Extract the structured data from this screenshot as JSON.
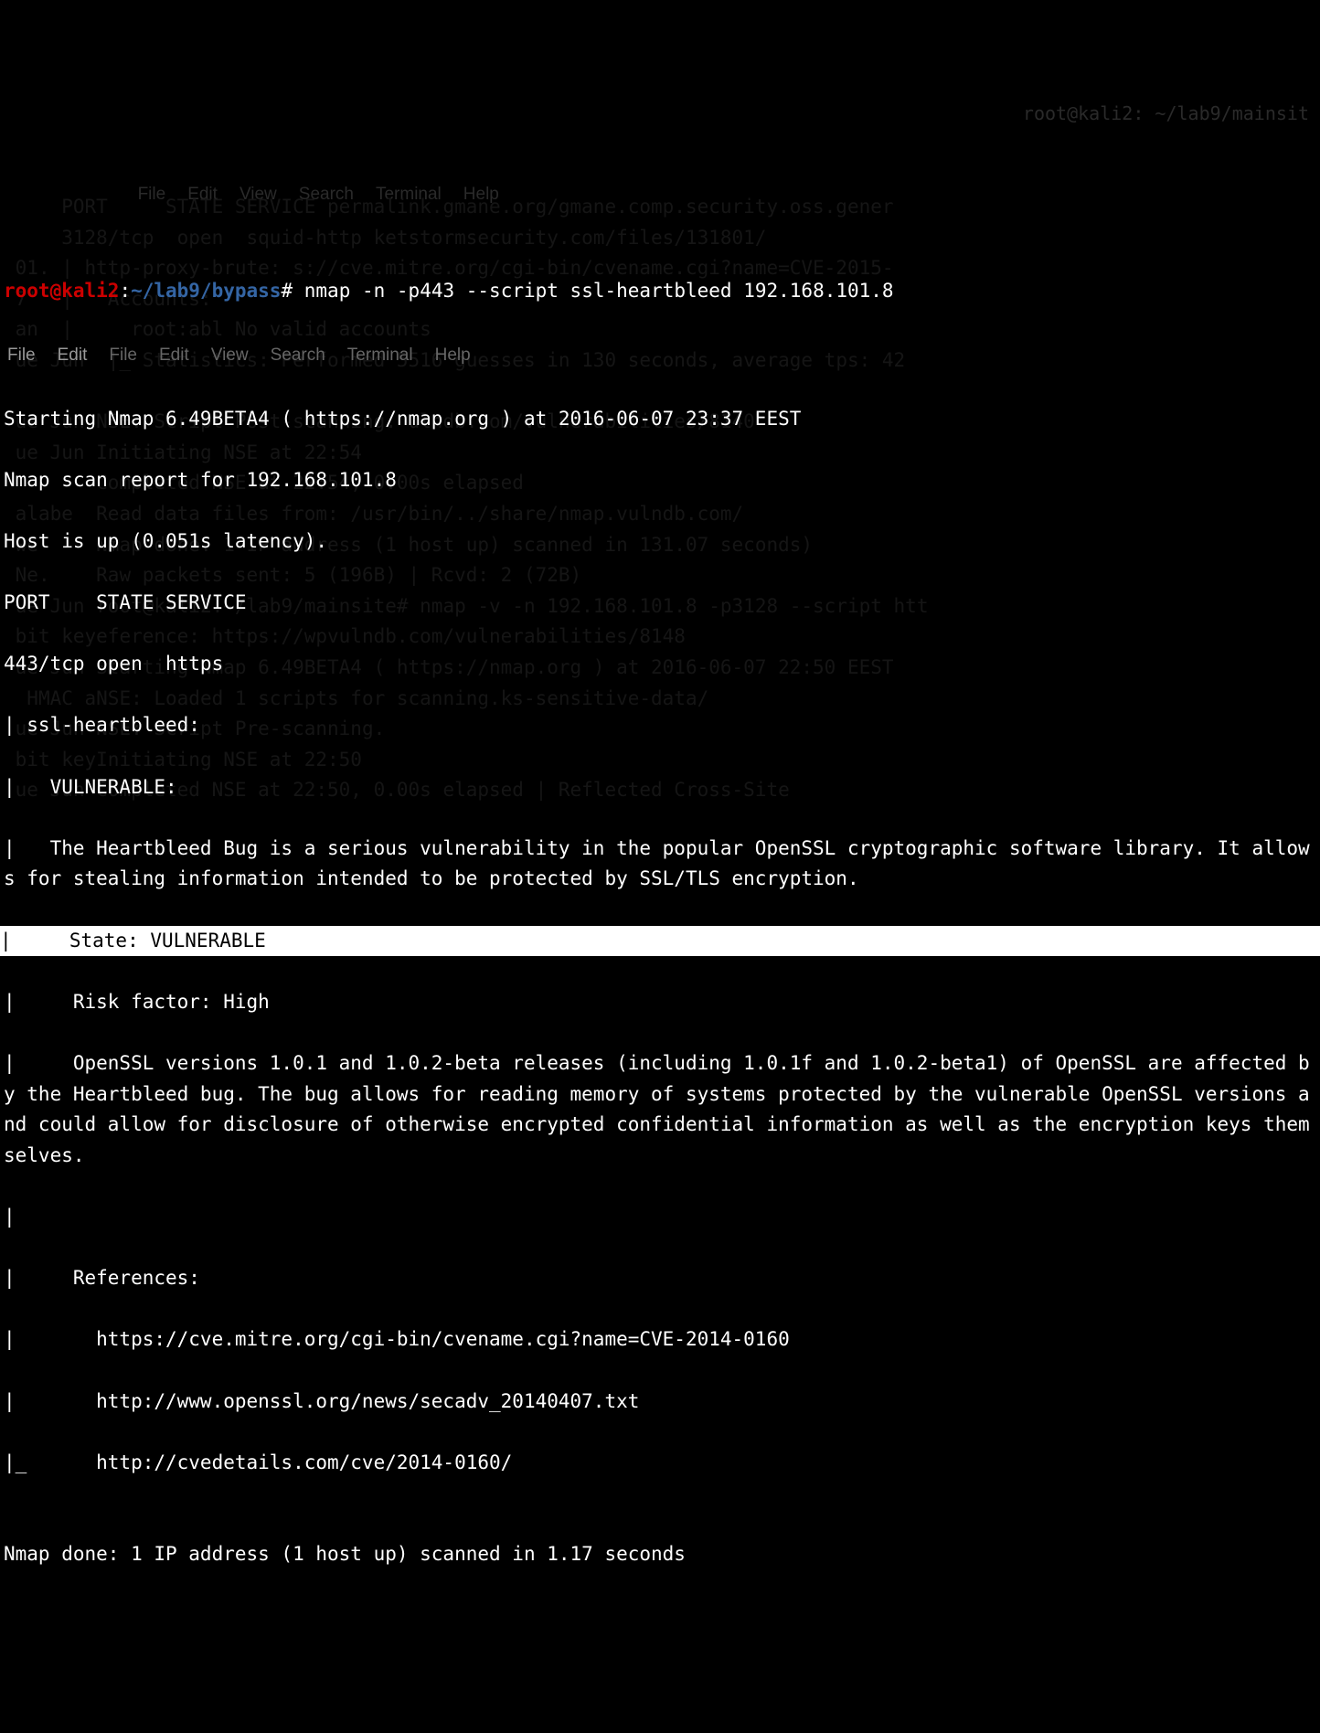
{
  "prompt": {
    "user_host": "root@kali2",
    "colon": ":",
    "path": "~/lab9/bypass",
    "hash": "#",
    "command": " nmap -n -p443 --script ssl-heartbleed 192.168.101.8"
  },
  "menubar1": {
    "file1": "File",
    "edit1": "Edit",
    "file2": "File",
    "edit2": "Edit",
    "view": "View",
    "search": "Search",
    "terminal": "Terminal",
    "help": "Help"
  },
  "output": {
    "starting": "Starting Nmap 6.49BETA4 ( https://nmap.org ) at 2016-06-07 23:37 EEST",
    "report": "Nmap scan report for 192.168.101.8",
    "hostup": "Host is up (0.051s latency).",
    "header": "PORT    STATE SERVICE",
    "port": "443/tcp open  https",
    "script": "| ssl-heartbleed:",
    "vuln": "|   VULNERABLE:",
    "desc": "|   The Heartbleed Bug is a serious vulnerability in the popular OpenSSL cryptographic software library. It allows for stealing information intended to be protected by SSL/TLS encryption.",
    "state": "|     State: VULNERABLE",
    "risk": "|     Risk factor: High",
    "versions": "|     OpenSSL versions 1.0.1 and 1.0.2-beta releases (including 1.0.1f and 1.0.2-beta1) of OpenSSL are affected by the Heartbleed bug. The bug allows for reading memory of systems protected by the vulnerable OpenSSL versions and could allow for disclosure of otherwise encrypted confidential information as well as the encryption keys themselves.",
    "pipe": "|",
    "refs": "|     References:",
    "ref1": "|       https://cve.mitre.org/cgi-bin/cvename.cgi?name=CVE-2014-0160",
    "ref2": "|       http://www.openssl.org/news/secadv_20140407.txt",
    "ref3": "|_      http://cvedetails.com/cve/2014-0160/",
    "blank": "",
    "done": "Nmap done: 1 IP address (1 host up) scanned in 1.17 seconds"
  },
  "bg": {
    "title": "root@kali2: ~/lab9/mainsit",
    "menubar": {
      "file": "File",
      "edit": "Edit",
      "view": "View",
      "search": "Search",
      "terminal": "Terminal",
      "help": "Help"
    },
    "lines": "     PORT     STATE SERVICE permalink.gmane.org/gmane.comp.security.oss.gener\n     3128/tcp  open  squid-http ketstormsecurity.com/files/131801/\n 01. | http-proxy-brute: s://cve.mitre.org/cgi-bin/cvename.cgi?name=CVE-2015-\n 7'  |   Accounts:\n an  |     root:abl No valid accounts\n ue Jun  |_ Statistics: Performed 5516 guesses in 130 seconds, average tps: 42\n\n ue Jun NSE: Script Post-scanning. ulndb.com/vulnerabilities/8140\n ue Jun Initiating NSE at 22:54\n        Completed NSE at 22:54, 0.00s elapsed\n alabe  Read data files from: /usr/bin/../share/nmap.vulndb.com/\n we     Nmap done: 1 IP address (1 host up) scanned in 131.07 seconds)\n Ne.    Raw packets sent: 5 (196B) | Rcvd: 2 (72B)\n ue Jun root@kali2:~/lab9/mainsite# nmap -v -n 192.168.101.8 -p3128 --script htt\n bit keyeference: https://wpvulndb.com/vulnerabilities/8148\n ue Jun Starting Nmap 6.49BETA4 ( https://nmap.org ) at 2016-06-07 22:50 EEST\n  HMAC aNSE: Loaded 1 scripts for scanning.ks-sensitive-data/\n ue Jun NSE: Script Pre-scanning.\n bit keyInitiating NSE at 22:50\n ue Jun Completed NSE at 22:50, 0.00s elapsed | Reflected Cross-Site"
  }
}
